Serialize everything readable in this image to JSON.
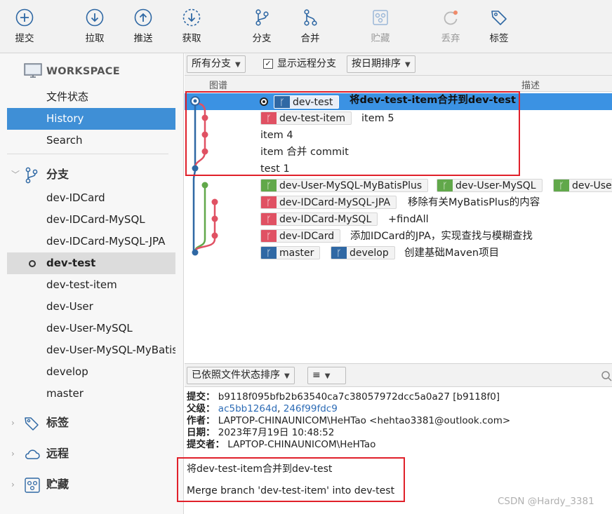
{
  "toolbar": {
    "items": [
      {
        "label": "提交",
        "icon": "plus-circle-icon"
      },
      {
        "label": "拉取",
        "icon": "arrow-down-circle-icon"
      },
      {
        "label": "推送",
        "icon": "arrow-up-circle-icon"
      },
      {
        "label": "获取",
        "icon": "dashed-arrow-down-circle-icon"
      },
      {
        "label": "分支",
        "icon": "branch-icon"
      },
      {
        "label": "合并",
        "icon": "merge-icon"
      },
      {
        "label": "贮藏",
        "icon": "stash-icon"
      },
      {
        "label": "丢弃",
        "icon": "discard-icon"
      },
      {
        "label": "标签",
        "icon": "tag-icon"
      }
    ]
  },
  "sidebar": {
    "workspace": {
      "title": "WORKSPACE",
      "items": [
        "文件状态",
        "History",
        "Search"
      ],
      "selected": "History"
    },
    "branches": {
      "title": "分支",
      "items": [
        "dev-IDCard",
        "dev-IDCard-MySQL",
        "dev-IDCard-MySQL-JPA",
        "dev-test",
        "dev-test-item",
        "dev-User",
        "dev-User-MySQL",
        "dev-User-MySQL-MyBatis",
        "develop",
        "master"
      ],
      "current": "dev-test"
    },
    "tags": {
      "title": "标签"
    },
    "remotes": {
      "title": "远程"
    },
    "stashes": {
      "title": "贮藏"
    }
  },
  "filters": {
    "branches": "所有分支",
    "show_remote": "显示远程分支",
    "sort": "按日期排序"
  },
  "columns": {
    "graph": "图谱",
    "description": "描述"
  },
  "commits": [
    {
      "badges": [
        {
          "name": "dev-test",
          "color": "blue",
          "head": true
        }
      ],
      "message": "将dev-test-item合并到dev-test",
      "selected": true
    },
    {
      "badges": [
        {
          "name": "dev-test-item",
          "color": "red"
        }
      ],
      "message": "item 5"
    },
    {
      "badges": [],
      "message": "item 4"
    },
    {
      "badges": [],
      "message": "item 合并 commit"
    },
    {
      "badges": [],
      "message": "test 1"
    },
    {
      "badges": [
        {
          "name": "dev-User-MySQL-MyBatisPlus",
          "color": "green"
        },
        {
          "name": "dev-User-MySQL",
          "color": "green"
        },
        {
          "name": "dev-User",
          "color": "green"
        }
      ],
      "message": ""
    },
    {
      "badges": [
        {
          "name": "dev-IDCard-MySQL-JPA",
          "color": "red"
        }
      ],
      "message": "移除有关MyBatisPlus的内容"
    },
    {
      "badges": [
        {
          "name": "dev-IDCard-MySQL",
          "color": "red"
        }
      ],
      "message": "+findAll"
    },
    {
      "badges": [
        {
          "name": "dev-IDCard",
          "color": "red"
        }
      ],
      "message": "添加IDCard的JPA，实现查找与模糊查找"
    },
    {
      "badges": [
        {
          "name": "master",
          "color": "blue"
        },
        {
          "name": "develop",
          "color": "blue"
        }
      ],
      "message": "创建基础Maven项目"
    }
  ],
  "detail_toolbar": {
    "sort": "已依照文件状态排序",
    "view": "≡"
  },
  "details": {
    "commit_label": "提交：",
    "commit_value": "b9118f095bfb2b63540ca7c38057972dcc5a0a27 [b9118f0]",
    "parents_label": "父级：",
    "parent1": "ac5bb1264d",
    "parent_sep": ", ",
    "parent2": "246f99fdc9",
    "author_label": "作者：",
    "author_value": "LAPTOP-CHINAUNICOM\\HeHTao <hehtao3381@outlook.com>",
    "date_label": "日期：",
    "date_value": "2023年7月19日 10:48:52",
    "committer_label": "提交者：",
    "committer_value": "LAPTOP-CHINAUNICOM\\HeHTao",
    "message_line1": "将dev-test-item合并到dev-test",
    "message_line2": "Merge branch 'dev-test-item' into dev-test"
  },
  "watermark": "CSDN @Hardy_3381",
  "colors": {
    "selection": "#3b92e3",
    "sidebar_selected": "#3f8fd6",
    "branch_red": "#e05163",
    "branch_green": "#61a84a",
    "branch_blue": "#2f68a4",
    "annotation_box": "#e0202a"
  }
}
